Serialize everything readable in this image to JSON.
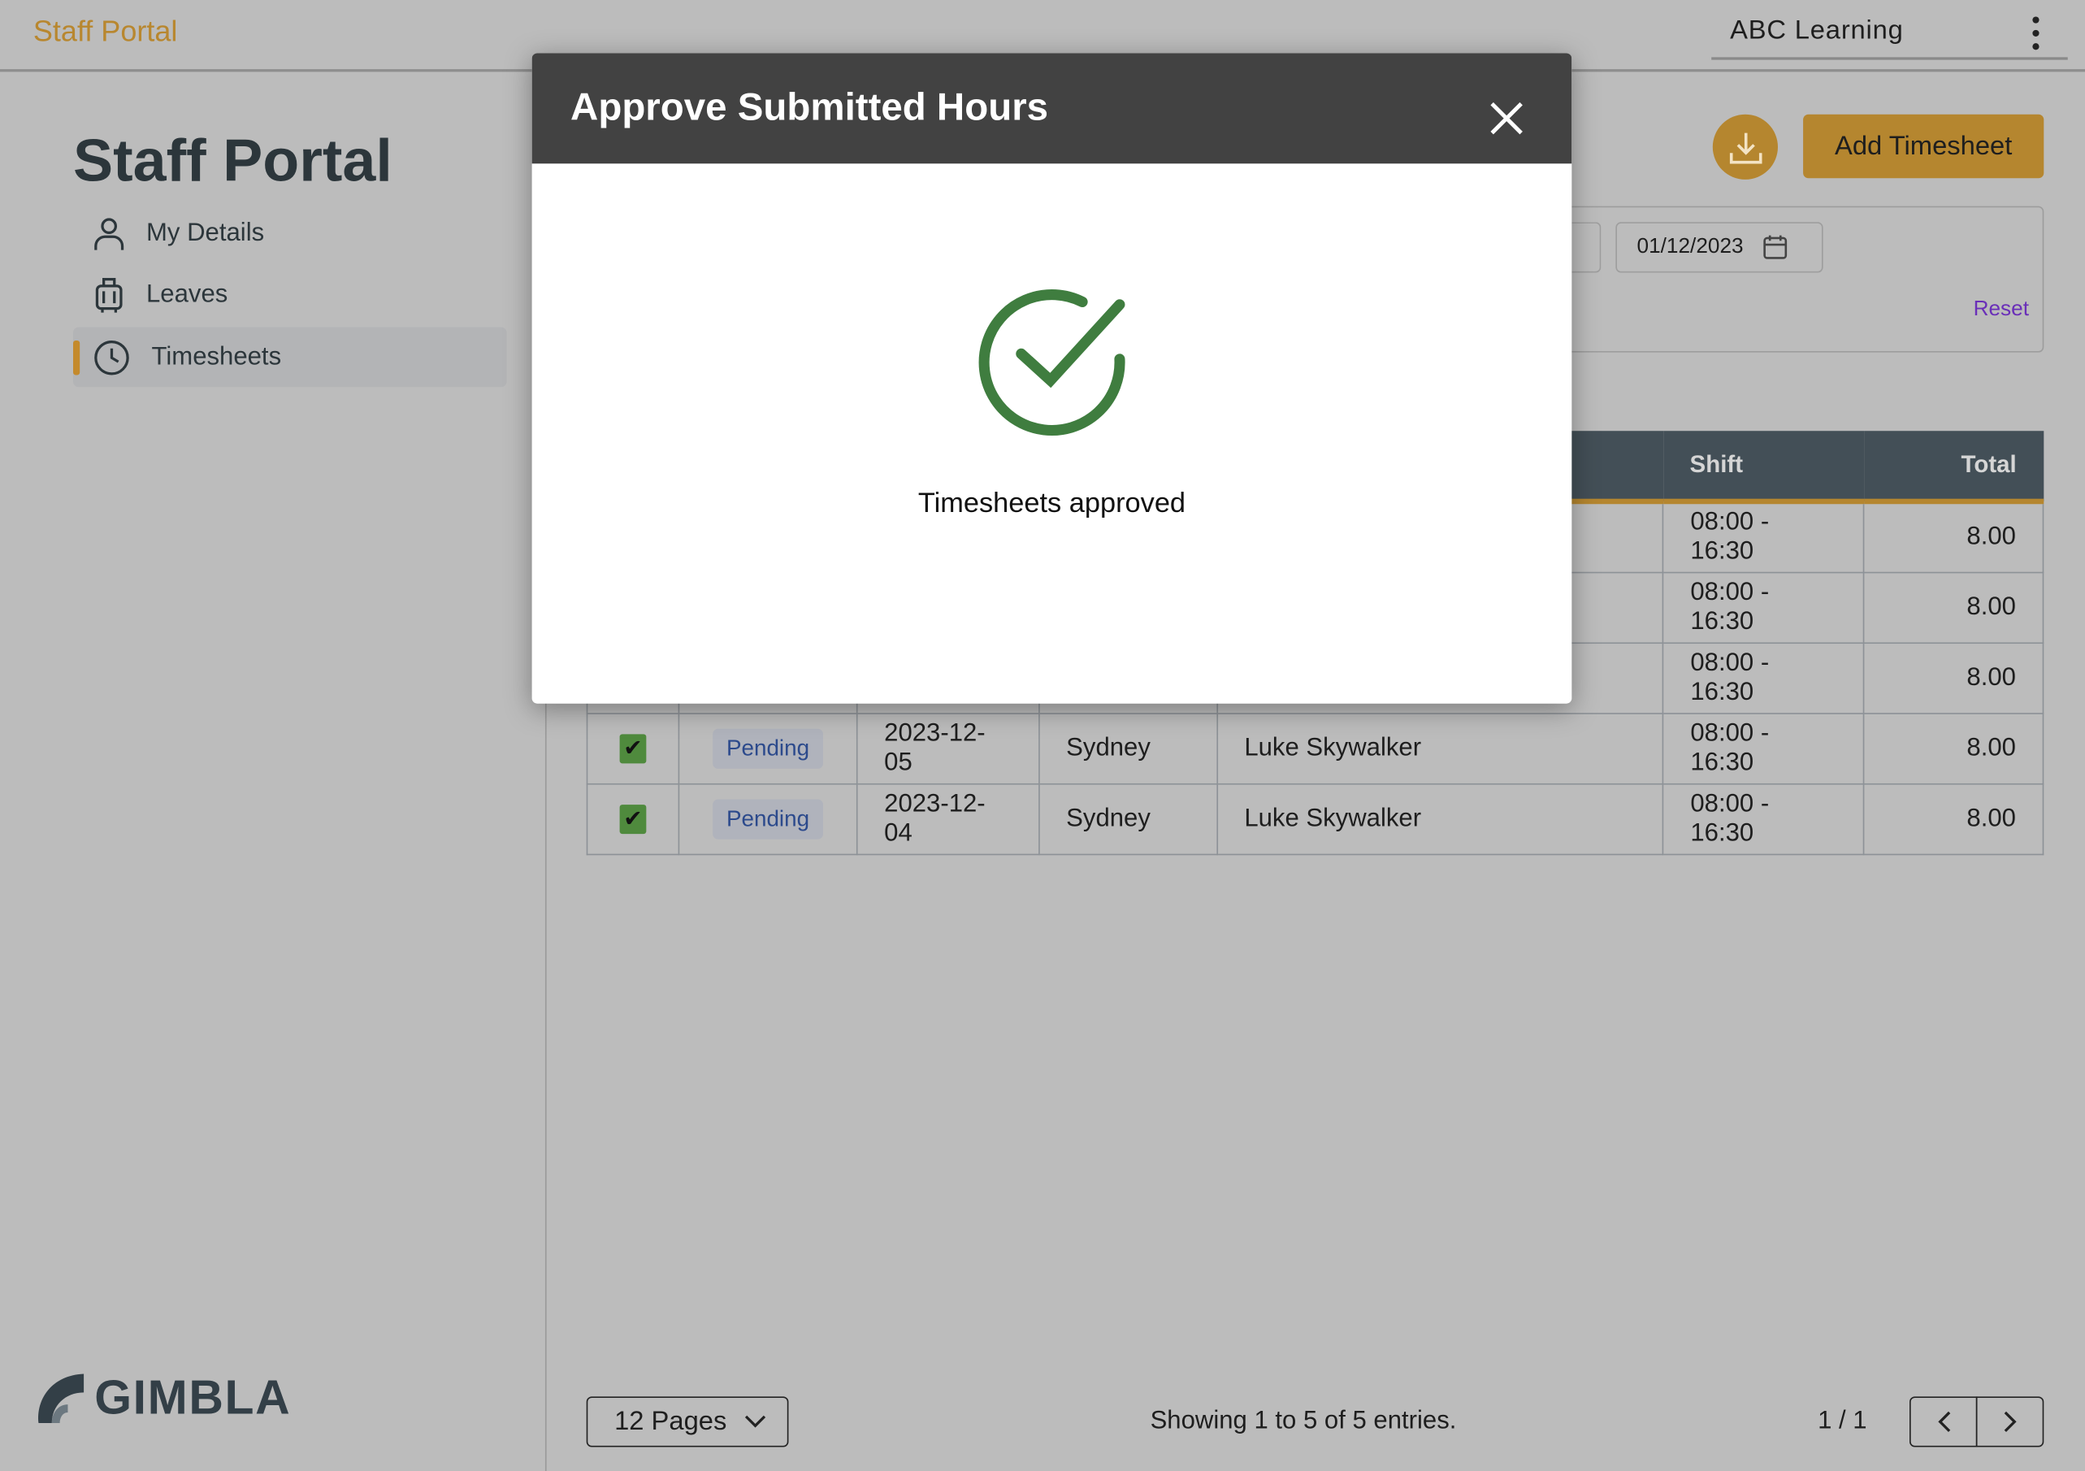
{
  "topbar": {
    "brand": "Staff Portal",
    "organization": "ABC Learning"
  },
  "sidebar": {
    "title": "Staff Portal",
    "items": [
      {
        "label": "My Details",
        "icon": "user-icon"
      },
      {
        "label": "Leaves",
        "icon": "luggage-icon"
      },
      {
        "label": "Timesheets",
        "icon": "clock-icon",
        "active": true
      }
    ],
    "logo": "GIMBLA"
  },
  "toolbar": {
    "add_label": "Add Timesheet",
    "download_icon": "download-icon"
  },
  "filter": {
    "date": "01/12/2023",
    "reset_label": "Reset"
  },
  "table": {
    "headers": [
      "",
      "",
      "",
      "",
      "",
      "Shift",
      "Total"
    ],
    "rows": [
      {
        "checked": true,
        "status": "",
        "date": "",
        "location": "",
        "name": "",
        "shift": "08:00 - 16:30",
        "total": "8.00"
      },
      {
        "checked": true,
        "status": "",
        "date": "",
        "location": "",
        "name": "",
        "shift": "08:00 - 16:30",
        "total": "8.00"
      },
      {
        "checked": true,
        "status": "",
        "date": "",
        "location": "",
        "name": "",
        "shift": "08:00 - 16:30",
        "total": "8.00"
      },
      {
        "checked": true,
        "status": "Pending",
        "date": "2023-12-05",
        "location": "Sydney",
        "name": "Luke Skywalker",
        "shift": "08:00 - 16:30",
        "total": "8.00"
      },
      {
        "checked": true,
        "status": "Pending",
        "date": "2023-12-04",
        "location": "Sydney",
        "name": "Luke Skywalker",
        "shift": "08:00 - 16:30",
        "total": "8.00"
      }
    ]
  },
  "footer": {
    "page_size": "12 Pages",
    "showing": "Showing 1 to 5 of 5 entries.",
    "page": "1 / 1"
  },
  "modal": {
    "title": "Approve Submitted Hours",
    "message": "Timesheets approved",
    "icon": "check-circle-icon"
  },
  "colors": {
    "accent": "#b5862f",
    "success": "#3f7d3f",
    "modal_header": "#424242",
    "table_header": "#434f57"
  }
}
